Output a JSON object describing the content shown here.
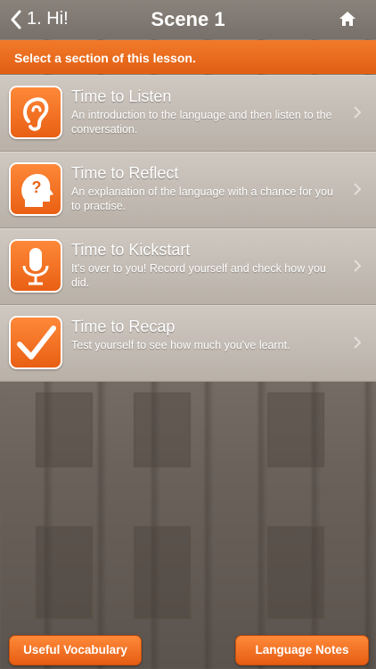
{
  "nav": {
    "back_label": "1. Hi!",
    "title": "Scene 1"
  },
  "banner": {
    "text": "Select a section of this lesson."
  },
  "sections": [
    {
      "title": "Time to Listen",
      "description": "An introduction to the language and then listen to the conversation.",
      "icon": "ear-icon"
    },
    {
      "title": "Time to Reflect",
      "description": "An explanation of the language with a chance for you to practise.",
      "icon": "head-question-icon"
    },
    {
      "title": "Time to Kickstart",
      "description": "It's over to you! Record yourself and check how you did.",
      "icon": "microphone-icon"
    },
    {
      "title": "Time to Recap",
      "description": "Test yourself to see how much you've learnt.",
      "icon": "checkmark-icon"
    }
  ],
  "footer": {
    "vocab_label": "Useful Vocabulary",
    "notes_label": "Language Notes"
  },
  "colors": {
    "accent": "#e8641a",
    "nav": "#7f7872"
  }
}
